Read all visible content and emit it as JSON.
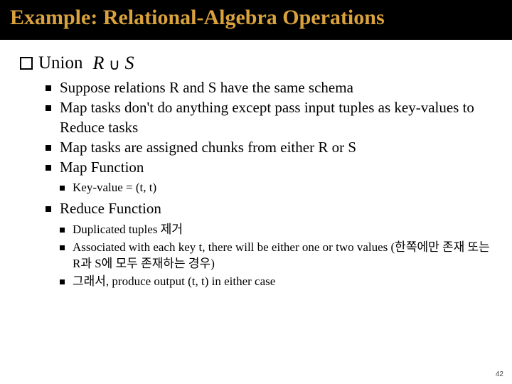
{
  "title": "Example: Relational-Algebra Operations",
  "section": {
    "heading": "Union",
    "expr_left": "R",
    "expr_op": "∪",
    "expr_right": "S"
  },
  "bullets": {
    "b1": "Suppose relations R and S have the same schema",
    "b2": "Map tasks don't do anything except pass input tuples as key-values to Reduce tasks",
    "b3": "Map tasks are assigned chunks from either R or S",
    "b4": "Map Function",
    "b4_sub1": "Key-value = (t, t)",
    "b5": "Reduce Function",
    "b5_sub1": "Duplicated tuples 제거",
    "b5_sub2": "Associated with each key t, there will be either one or two values (한쪽에만 존재 또는 R과 S에 모두 존재하는 경우)",
    "b5_sub3": "그래서, produce output (t, t) in either case"
  },
  "page": "42"
}
